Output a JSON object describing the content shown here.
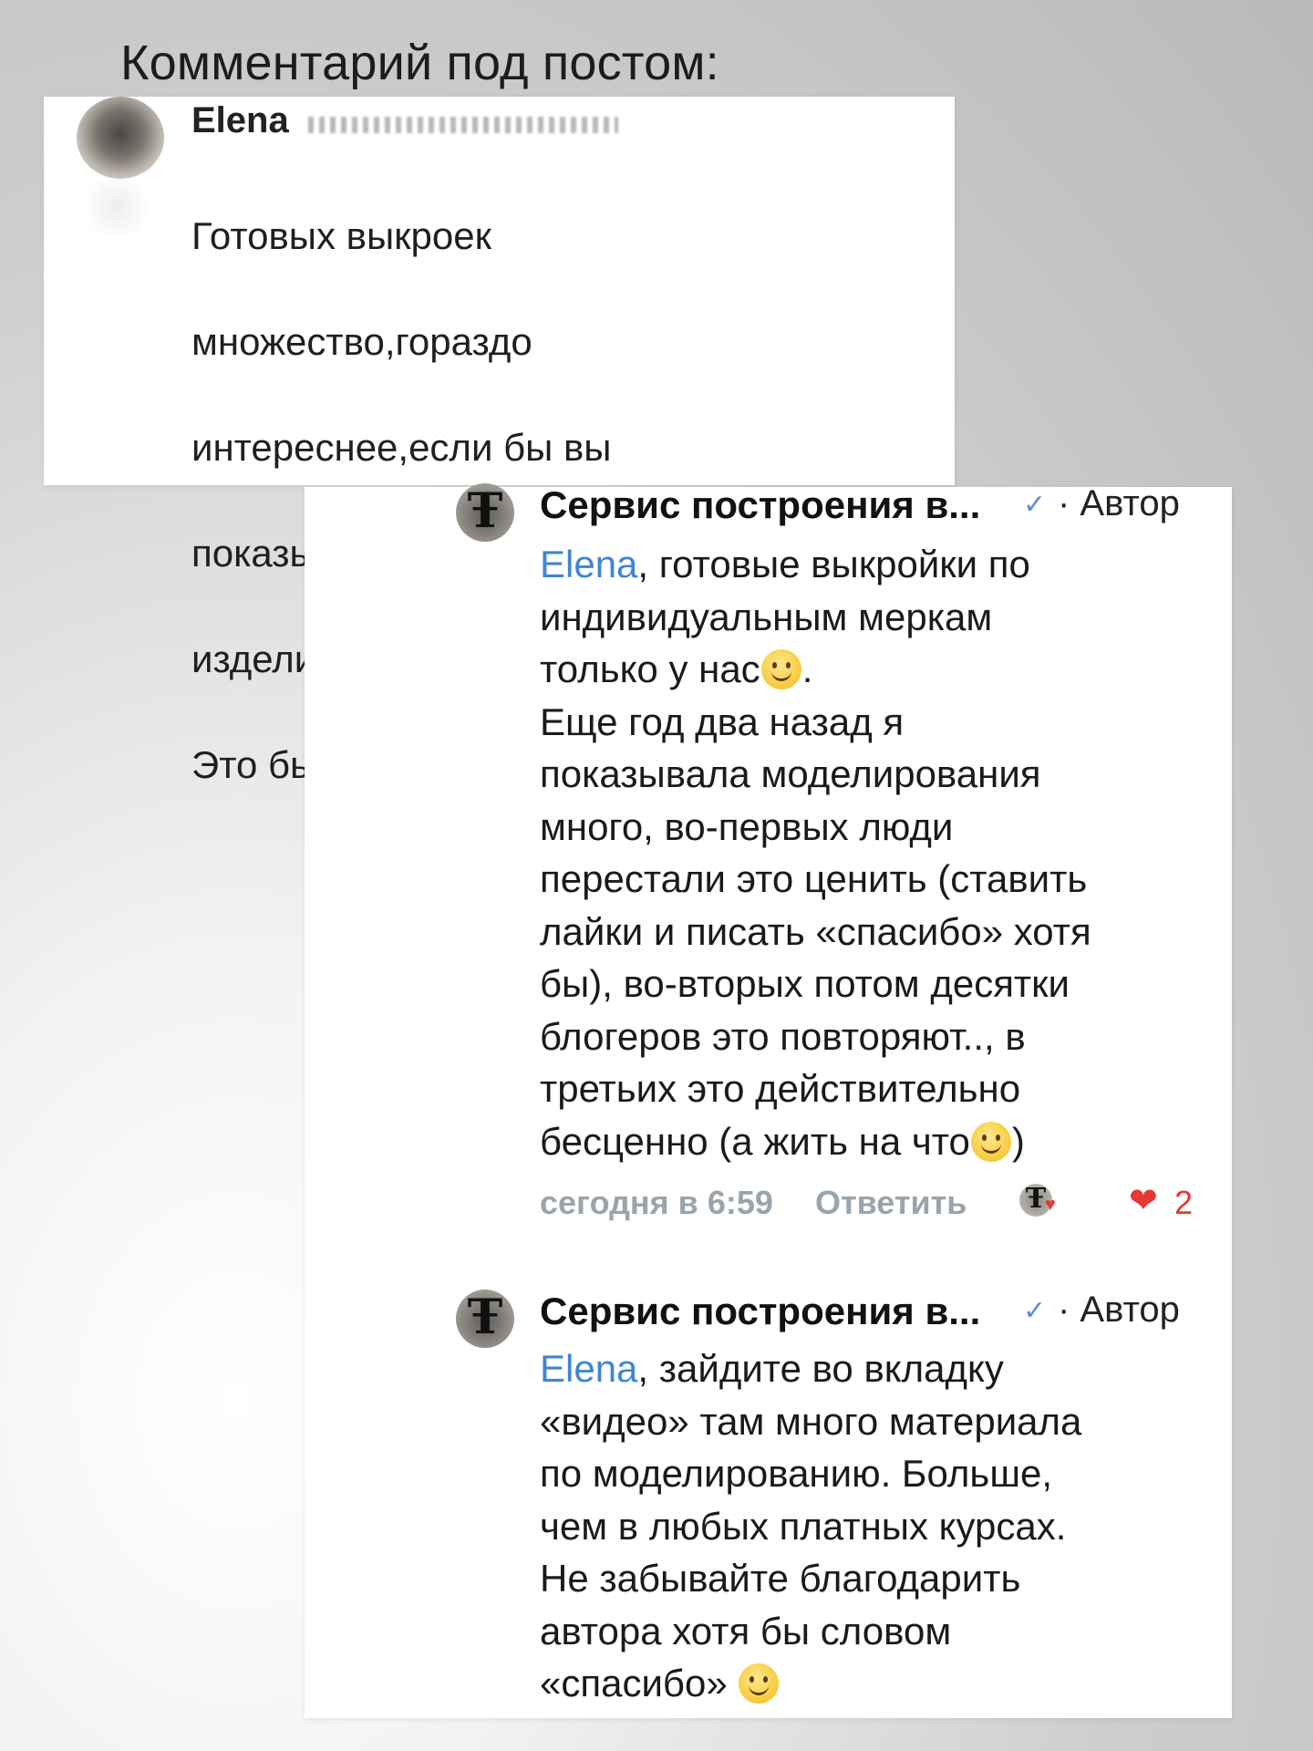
{
  "heading": "Комментарий под постом:",
  "top_comment": {
    "author": "Elena",
    "text_lines": [
      "Готовых выкроек",
      "множество,гораздо",
      "интереснее,если бы вы",
      "показывали моделирование",
      "изделий по базовым выкройкам!",
      "Это было бы бесценно!"
    ]
  },
  "reply1": {
    "author": "Сервис построения в...",
    "verified_icon": "✓",
    "role": "· Автор",
    "mention": "Elena",
    "lines": [
      ", готовые выкройки по",
      "индивидуальным меркам",
      "только у нас",
      ".",
      "Еще год два назад я",
      "показывала моделирования",
      "много, во-первых люди",
      "перестали это ценить (ставить",
      "лайки и  писать «спасибо» хотя",
      "бы), во-вторых потом десятки",
      "блогеров это повторяют.., в",
      "третьих это действительно",
      "бесценно (а жить на что",
      ")"
    ],
    "time": "сегодня в 6:59",
    "reply_label": "Ответить",
    "likes": "2",
    "like_icon": "❤",
    "author_like_icon": "♥"
  },
  "reply2": {
    "author": "Сервис построения в...",
    "verified_icon": "✓",
    "role": "· Автор",
    "mention": "Elena",
    "lines": [
      ", зайдите во вкладку",
      "«видео» там много материала",
      "по моделированию. Больше,",
      "чем в любых платных курсах.",
      "Не забывайте благодарить",
      "автора хотя бы словом",
      "«спасибо»"
    ]
  },
  "avatar_glyph": "Ŧ",
  "colors": {
    "mention": "#3f85d3",
    "meta": "#9aa4ad",
    "like": "#e53935",
    "verified": "#5a8fd6"
  }
}
